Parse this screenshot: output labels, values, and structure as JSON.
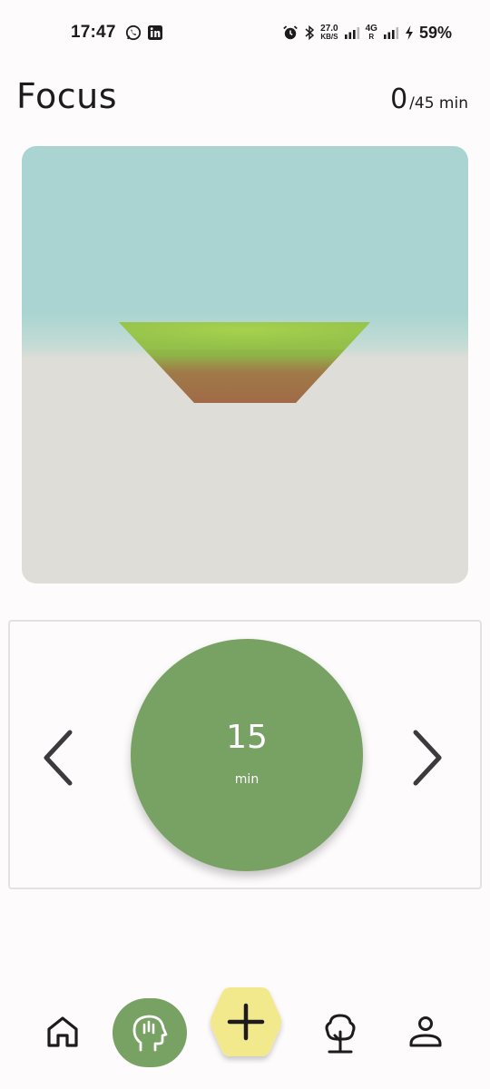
{
  "status_bar": {
    "time": "17:47",
    "net_speed_value": "27.0",
    "net_speed_unit": "KB/S",
    "network_type": "4G",
    "network_sub": "R",
    "battery": "59%"
  },
  "header": {
    "title": "Focus",
    "progress_current": "0",
    "progress_goal": "/45 min"
  },
  "timer": {
    "value": "15",
    "unit": "min"
  },
  "colors": {
    "accent_green": "#78a164",
    "add_button_yellow": "#f2e98c",
    "sky": "#a9d4d1",
    "ground": "#dfddd7"
  },
  "bottom_nav": {
    "items": [
      {
        "name": "home",
        "icon": "home-icon",
        "active": false
      },
      {
        "name": "focus",
        "icon": "focus-head-icon",
        "active": true
      },
      {
        "name": "add",
        "icon": "plus-icon",
        "active": false
      },
      {
        "name": "forest",
        "icon": "tree-icon",
        "active": false
      },
      {
        "name": "profile",
        "icon": "person-icon",
        "active": false
      }
    ]
  }
}
